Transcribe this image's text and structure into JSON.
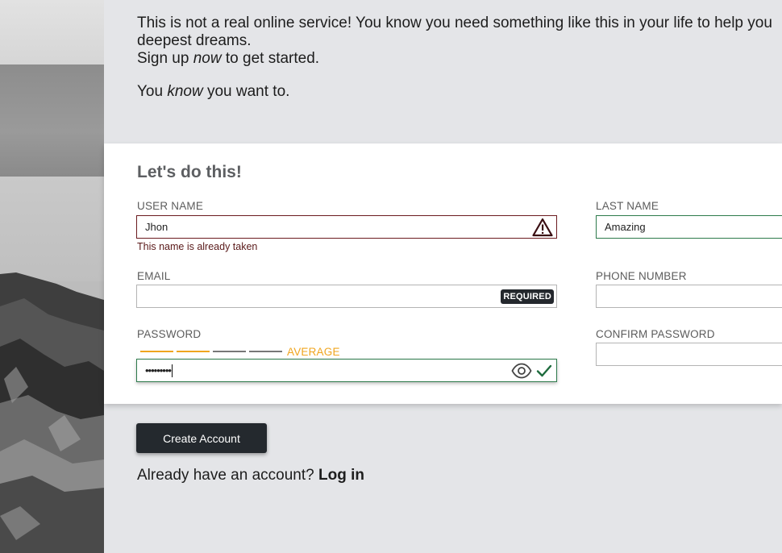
{
  "intro": {
    "line1": "This is not a real online service! You know you need something like this in your life to help you",
    "line2": "deepest dreams.",
    "line3_pre": "Sign up ",
    "line3_em": "now",
    "line3_post": " to get started.",
    "line4_pre": "You ",
    "line4_em": "know",
    "line4_post": " you want to."
  },
  "form": {
    "heading": "Let's do this!",
    "username": {
      "label": "USER NAME",
      "value": "Jhon",
      "error": "This name is already taken",
      "icon": "warning-triangle-icon"
    },
    "lastname": {
      "label": "LAST NAME",
      "value": "Amazing"
    },
    "email": {
      "label": "EMAIL",
      "value": "",
      "badge": "REQUIRED"
    },
    "phone": {
      "label": "PHONE NUMBER",
      "value": ""
    },
    "password": {
      "label": "PASSWORD",
      "value": "•••••••••",
      "strength_label": "AVERAGE",
      "strength_filled": 2,
      "strength_total": 4,
      "icons": [
        "eye-icon",
        "checkmark-icon"
      ]
    },
    "confirm": {
      "label": "CONFIRM PASSWORD",
      "value": ""
    }
  },
  "actions": {
    "create_label": "Create Account",
    "login_prompt": "Already have an account? ",
    "login_link": "Log in"
  },
  "colors": {
    "accent_dark": "#24292e",
    "error": "#6b1a1f",
    "success": "#2d7a4b",
    "strength": "#f0a51e"
  }
}
